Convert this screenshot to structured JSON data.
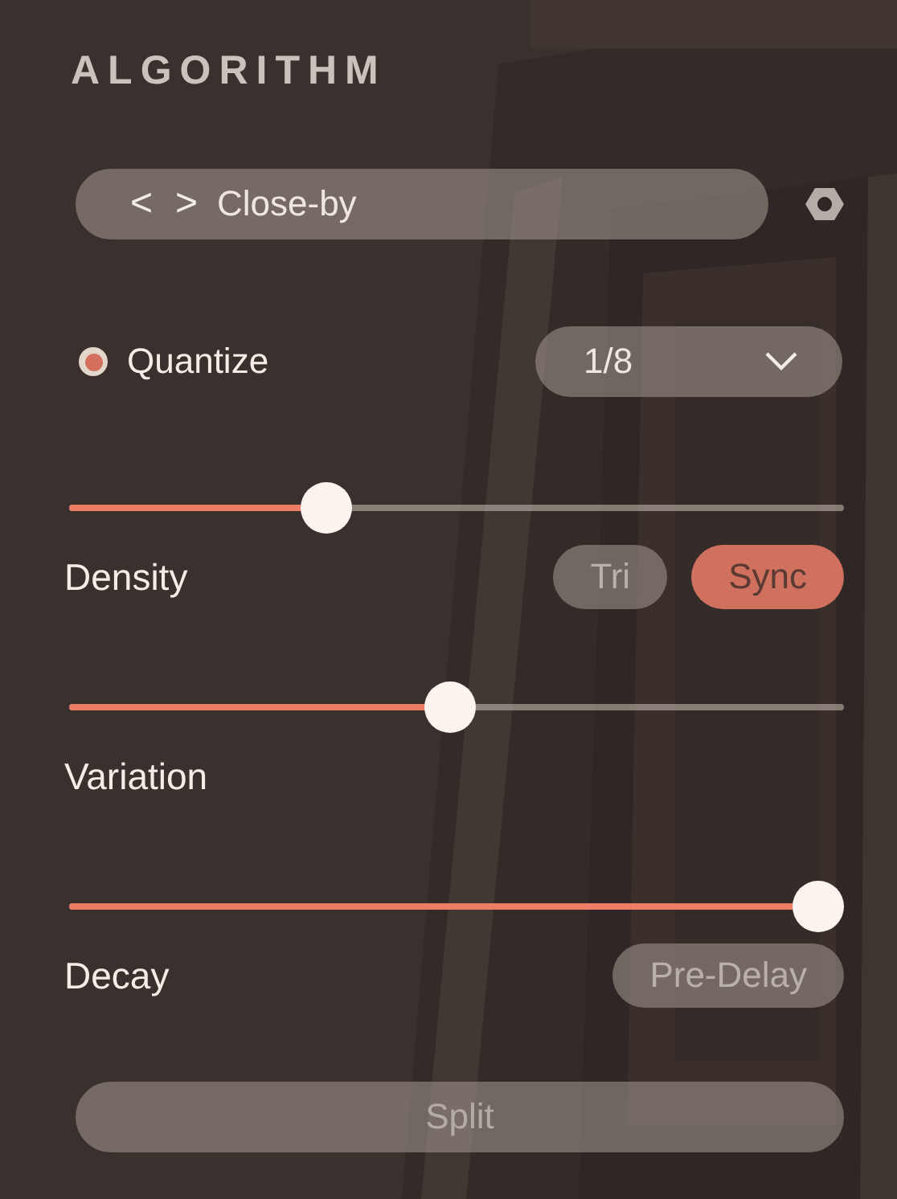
{
  "header": {
    "title": "ALGORITHM"
  },
  "preset": {
    "prev": "<",
    "next": ">",
    "name": "Close-by"
  },
  "quantize": {
    "label": "Quantize",
    "checked": true,
    "value": "1/8"
  },
  "sliders": [
    {
      "label": "Density",
      "level": 0.32,
      "options": [
        {
          "label": "Tri",
          "selected": false
        },
        {
          "label": "Sync",
          "selected": true
        }
      ]
    },
    {
      "label": "Variation",
      "level": 0.49
    },
    {
      "label": "Decay",
      "level": 1,
      "toggle": {
        "label": "Pre-Delay",
        "on": false
      }
    }
  ],
  "split": {
    "label": "Split",
    "on": false
  }
}
